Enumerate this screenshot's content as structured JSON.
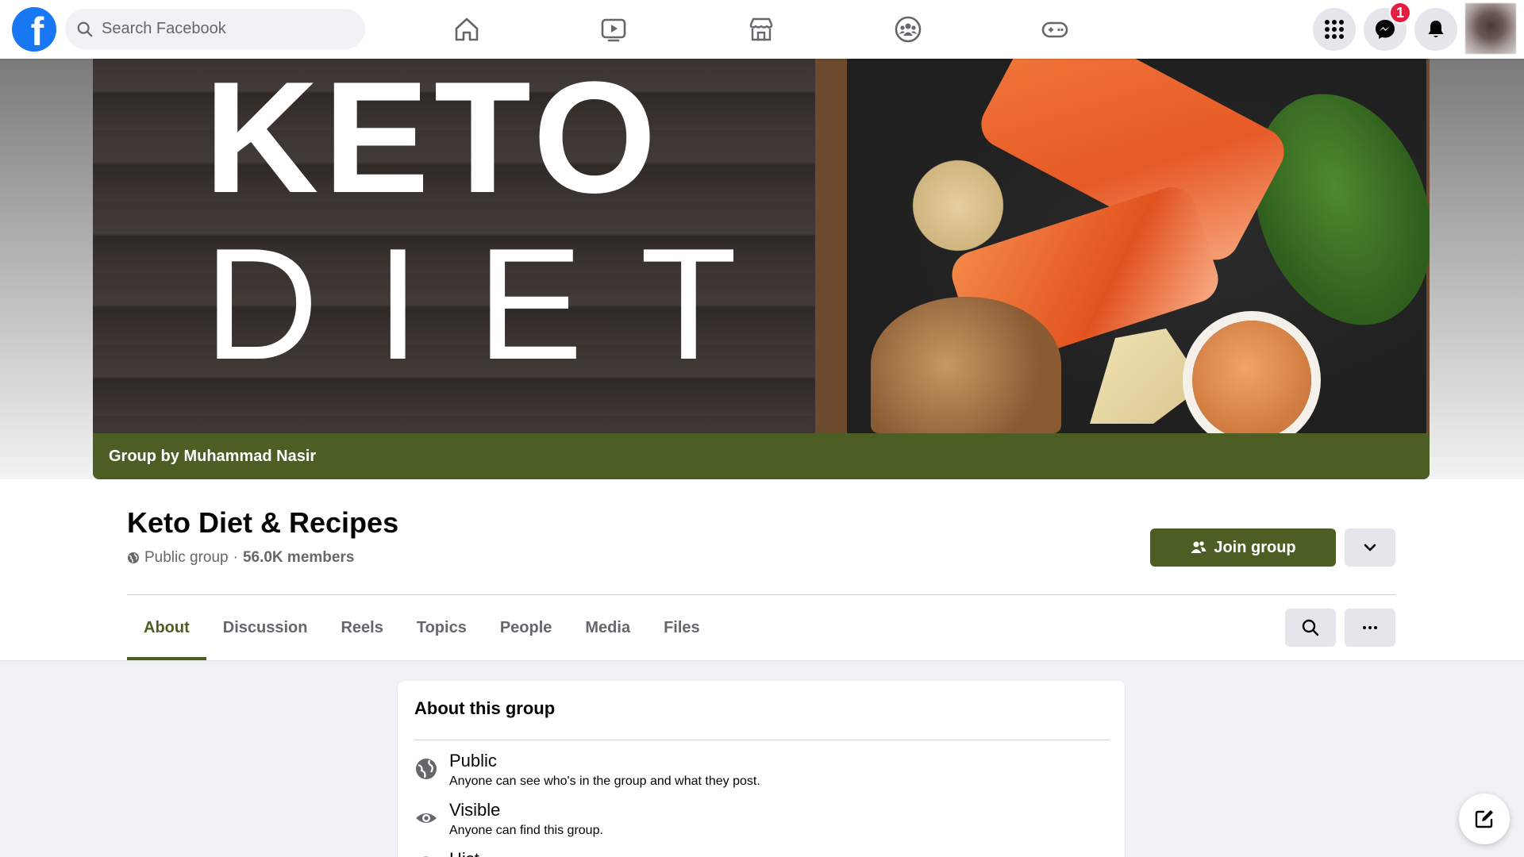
{
  "topbar": {
    "logo_letter": "f",
    "search_placeholder": "Search Facebook",
    "nav_icons": [
      "home-icon",
      "watch-icon",
      "marketplace-icon",
      "groups-icon",
      "gaming-icon"
    ],
    "messenger_badge": "1"
  },
  "cover": {
    "title_line1": "KETO",
    "title_line2": "DIET",
    "group_by": "Group by Muhammad Nasir"
  },
  "group": {
    "name": "Keto Diet & Recipes",
    "privacy": "Public group",
    "separator": "·",
    "members": "56.0K members",
    "join_label": "Join group",
    "accent_color": "#4d5e24"
  },
  "tabs": [
    {
      "label": "About",
      "active": true
    },
    {
      "label": "Discussion",
      "active": false
    },
    {
      "label": "Reels",
      "active": false
    },
    {
      "label": "Topics",
      "active": false
    },
    {
      "label": "People",
      "active": false
    },
    {
      "label": "Media",
      "active": false
    },
    {
      "label": "Files",
      "active": false
    }
  ],
  "about": {
    "title": "About this group",
    "items": [
      {
        "title": "Public",
        "desc": "Anyone can see who's in the group and what they post.",
        "icon": "globe-icon"
      },
      {
        "title": "Visible",
        "desc": "Anyone can find this group.",
        "icon": "eye-icon"
      },
      {
        "title": "Hist",
        "desc": "",
        "icon": "history-icon"
      }
    ]
  }
}
